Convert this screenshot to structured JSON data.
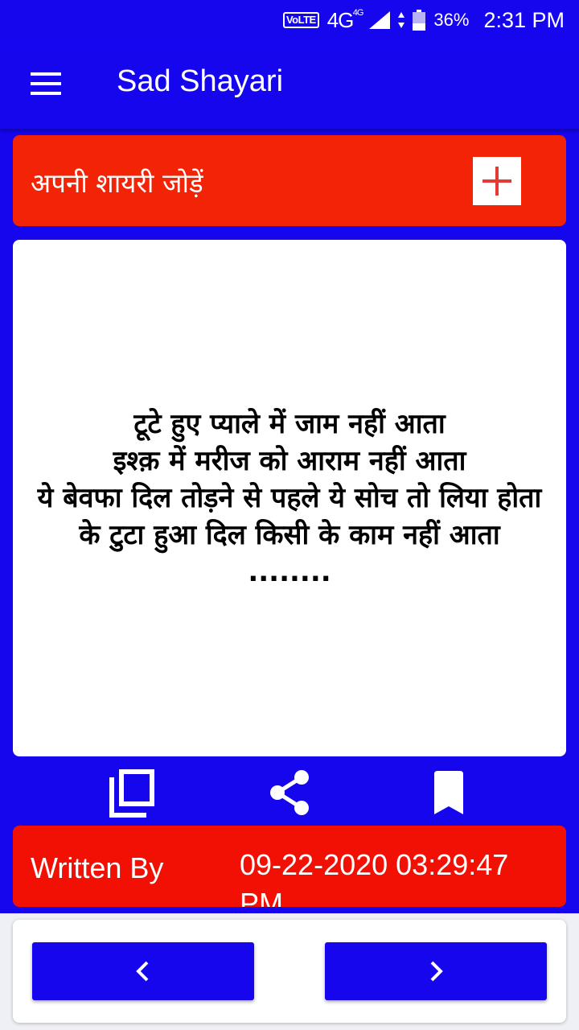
{
  "status_bar": {
    "volte": "VoLTE",
    "network": "4G",
    "network_sup": "4G",
    "battery": "36%",
    "time": "2:31 PM"
  },
  "app_bar": {
    "title": "Sad Shayari",
    "menu_icon": "hamburger-menu-icon"
  },
  "add_bar": {
    "label": "अपनी शायरी जोड़ें",
    "icon": "plus-icon",
    "icon_color": "#e53935"
  },
  "shayari": {
    "text": "टूटे हुए प्याले में जाम नहीं आता\nइश्क़ में मरीज को आराम नहीं आता\nये बेवफा दिल तोड़ने से पहले ये सोच तो लिया होता\nके टुटा हुआ दिल किसी के काम नहीं आता\n........"
  },
  "actions": {
    "copy_icon": "copy-icon",
    "share_icon": "share-icon",
    "bookmark_icon": "bookmark-icon"
  },
  "written_by": {
    "label": "Written By",
    "date": "09-22-2020 03:29:47",
    "date_overflow": "PM"
  },
  "navigation": {
    "prev_icon": "chevron-left-icon",
    "next_icon": "chevron-right-icon"
  },
  "colors": {
    "primary": "#1506ee",
    "accent_red": "#f22405",
    "card": "#ffffff"
  }
}
